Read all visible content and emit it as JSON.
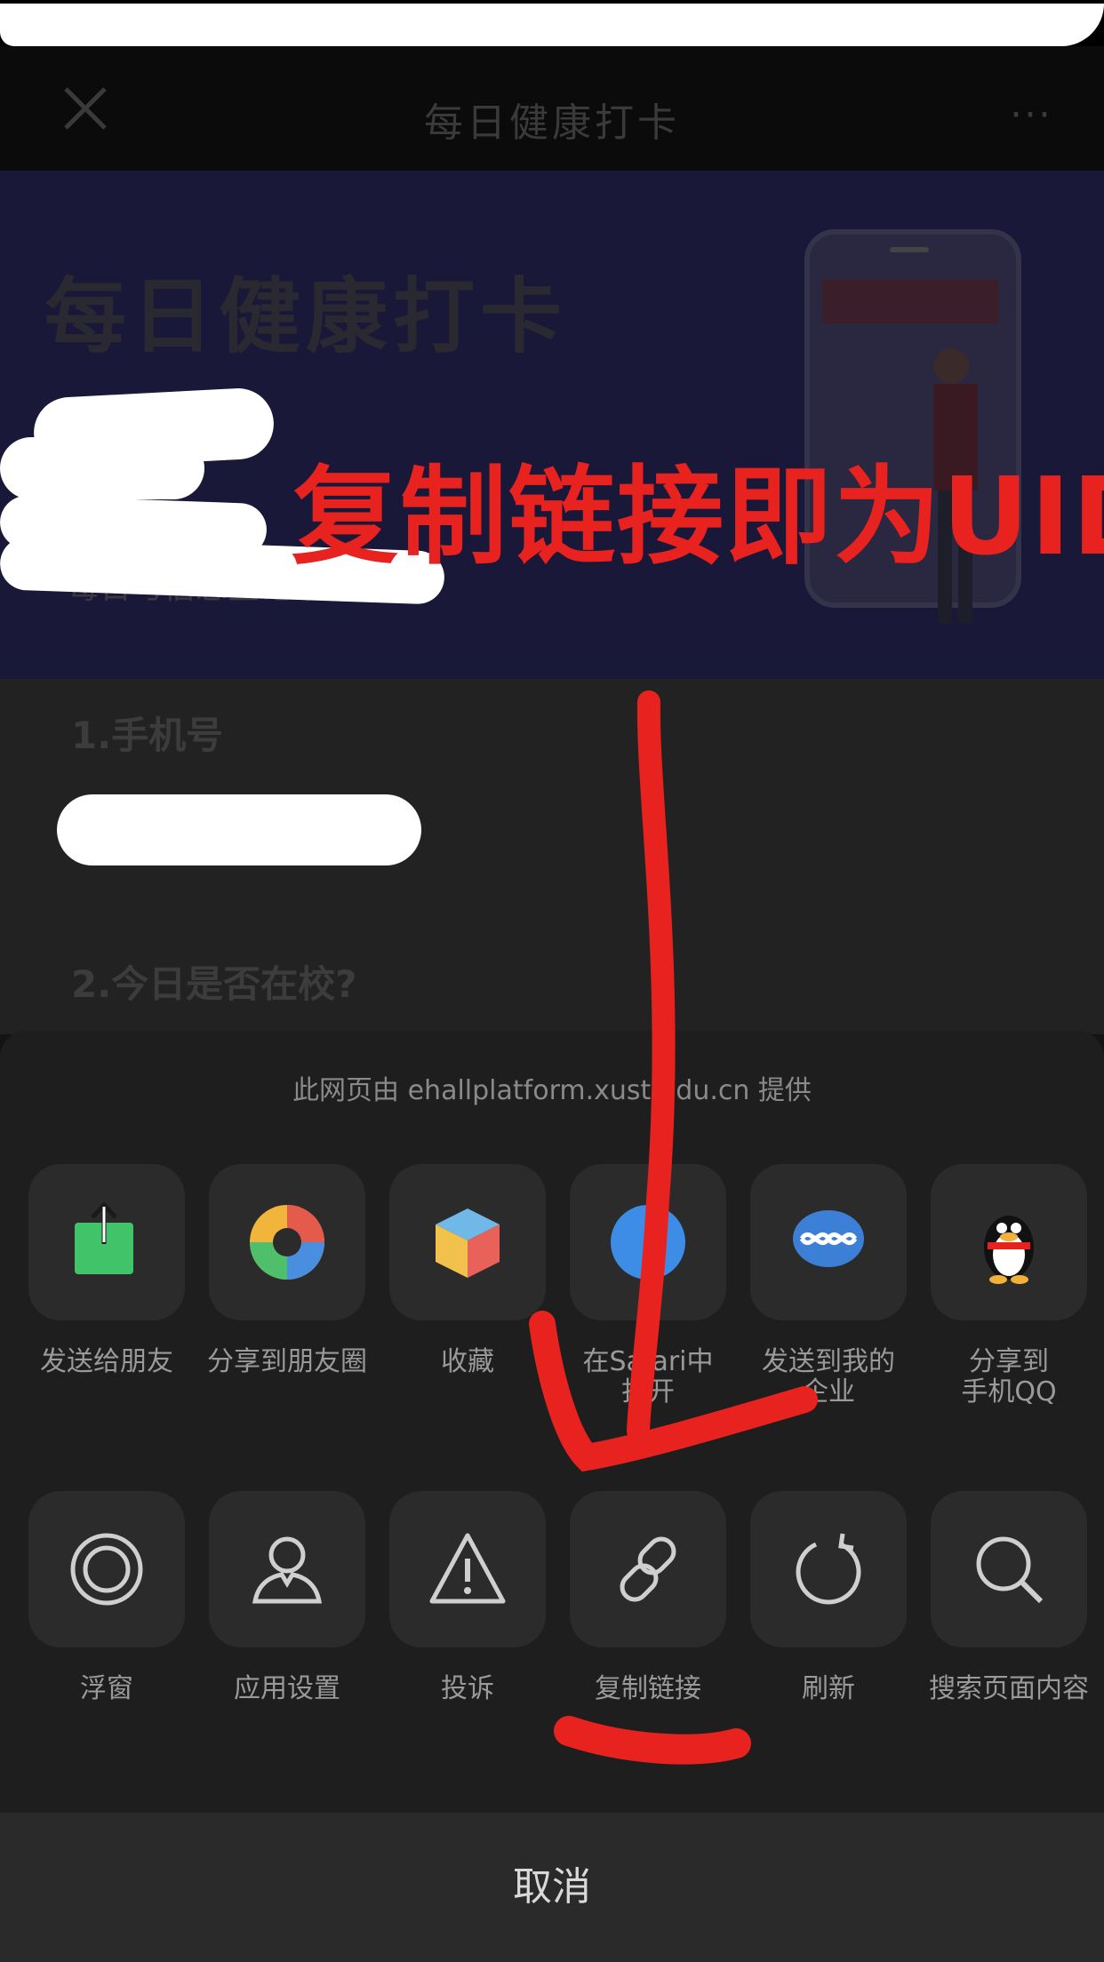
{
  "nav": {
    "title": "每日健康打卡",
    "more": "···"
  },
  "banner": {
    "title": "每日健康打卡",
    "subtitle": "每日与信息登记平台"
  },
  "annotation": {
    "text": "复制链接即为UID",
    "color": "#e8221e"
  },
  "form": {
    "q1": "1.手机号",
    "q2": "2.今日是否在校?"
  },
  "sheet": {
    "source": "此网页由 ehallplatform.xust.edu.cn 提供",
    "row1": [
      {
        "label": "发送给朋友",
        "icon": "share-green-icon"
      },
      {
        "label": "分享到朋友圈",
        "icon": "moments-icon"
      },
      {
        "label": "收藏",
        "icon": "favorite-cube-icon"
      },
      {
        "label": "在Safari中\n打开",
        "icon": "safari-icon"
      },
      {
        "label": "发送到我的\n企业",
        "icon": "wecom-icon"
      },
      {
        "label": "分享到\n手机QQ",
        "icon": "qq-penguin-icon"
      }
    ],
    "row2": [
      {
        "label": "浮窗",
        "icon": "float-window-icon"
      },
      {
        "label": "应用设置",
        "icon": "app-settings-icon"
      },
      {
        "label": "投诉",
        "icon": "warning-icon"
      },
      {
        "label": "复制链接",
        "icon": "link-icon"
      },
      {
        "label": "刷新",
        "icon": "refresh-icon"
      },
      {
        "label": "搜索页面内容",
        "icon": "search-icon"
      }
    ],
    "cancel": "取消"
  }
}
